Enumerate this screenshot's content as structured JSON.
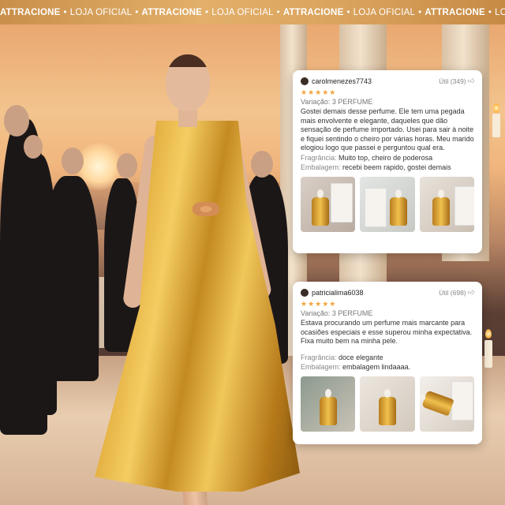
{
  "banner": {
    "items": [
      {
        "text": "ATTRACIONE",
        "bold": true
      },
      {
        "text": "LOJA OFICIAL",
        "bold": false
      },
      {
        "text": "ATTRACIONE",
        "bold": true
      },
      {
        "text": "LOJA OFICIAL",
        "bold": false
      },
      {
        "text": "ATTRACIONE",
        "bold": true
      },
      {
        "text": "LOJA OFICIAL",
        "bold": false
      },
      {
        "text": "ATTRACIONE",
        "bold": true
      },
      {
        "text": "LOJA OFICIAL",
        "bold": false
      },
      {
        "text": "ATTRACIONE",
        "bold": true
      },
      {
        "text": "LOJA OFI",
        "bold": false
      }
    ],
    "separator": "•",
    "color": "#d9a25c"
  },
  "reviews": [
    {
      "username": "carolmenezes7743",
      "useful": "Útil (349)",
      "rating": 5,
      "stars": "★★★★★",
      "variation": "Variação: 3 PERFUME",
      "text": "Gostei demais desse perfume. Ele tem uma pegada mais envolvente e elegante, daqueles que dão sensação de perfume importado. Usei para sair à noite e fiquei sentindo o cheiro por várias horas. Meu marido elogiou logo que passei e perguntou qual era.",
      "fragrance_label": "Fragrância:",
      "fragrance_value": "Muito top, cheiro de poderosa",
      "packaging_label": "Embalagem:",
      "packaging_value": "recebi beem rapido, gostei demais",
      "photo_icons": [
        "perfume-bottle-photo",
        "perfume-bottle-photo",
        "perfume-bottle-photo"
      ]
    },
    {
      "username": "patricialima6038",
      "useful": "Útil (698)",
      "rating": 5,
      "stars": "★★★★★",
      "variation": "Variação: 3 PERFUME",
      "text": "Estava procurando um perfume mais marcante para ocasiões especiais e esse superou minha expectativa. Fixa muito bem na minha pele.",
      "fragrance_label": "Fragrância:",
      "fragrance_value": "doce elegante",
      "packaging_label": "Embalagem:",
      "packaging_value": "embalagem lindaaaa.",
      "photo_icons": [
        "perfume-bottle-photo",
        "perfume-bottle-photo",
        "perfume-bottle-photo"
      ]
    }
  ],
  "colors": {
    "star": "#f1a43a",
    "gold": "#e0a93a"
  }
}
